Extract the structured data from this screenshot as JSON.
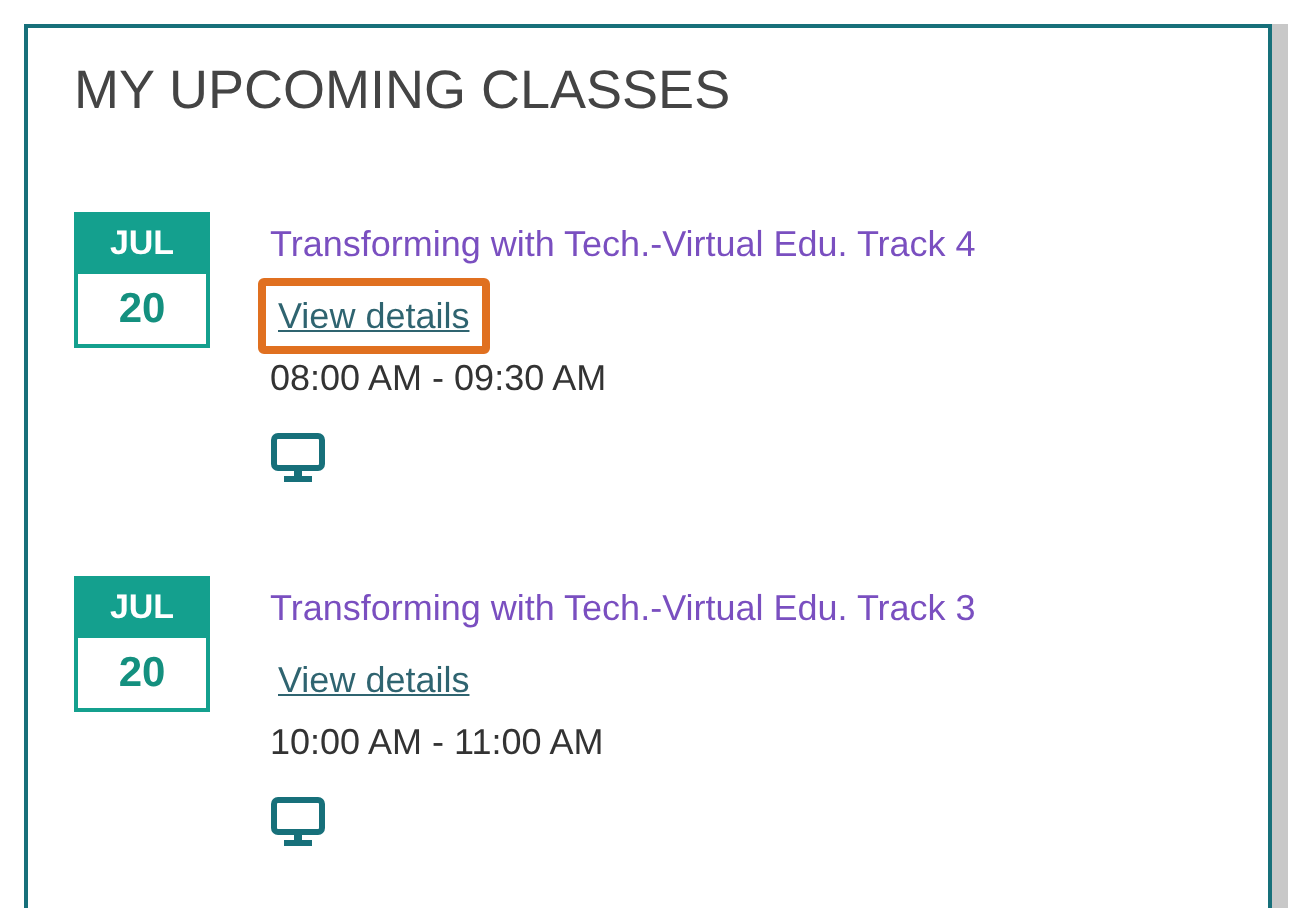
{
  "panel": {
    "title": "MY UPCOMING CLASSES"
  },
  "classes": [
    {
      "month": "JUL",
      "day": "20",
      "title": "Transforming with Tech.-Virtual Edu. Track 4",
      "link": "View details",
      "highlighted": true,
      "time": "08:00 AM - 09:30 AM"
    },
    {
      "month": "JUL",
      "day": "20",
      "title": "Transforming with Tech.-Virtual Edu. Track 3",
      "link": "View details",
      "highlighted": false,
      "time": "10:00 AM - 11:00 AM"
    }
  ]
}
